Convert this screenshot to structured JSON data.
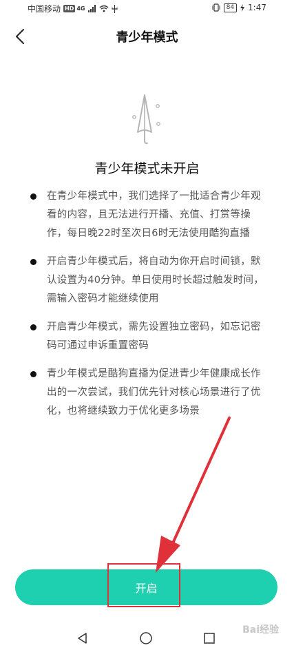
{
  "status_bar": {
    "carrier": "中国移动",
    "hd": "HD",
    "network": "4G",
    "battery": "84",
    "time": "1:47"
  },
  "header": {
    "title": "青少年模式"
  },
  "main": {
    "heading": "青少年模式未开启",
    "bullets": [
      "在青少年模式中，我们选择了一批适合青少年观看的内容，且无法进行开播、充值、打赏等操作，每日晚22时至次日6时无法使用酷狗直播",
      "开启青少年模式后，将自动为你开启时间锁，默认设置为40分钟。单日使用时长超过触发时间，需输入密码才能继续使用",
      "开启青少年模式，需先设置独立密码，如忘记密码可通过申诉重置密码",
      "青少年模式是酷狗直播为促进青少年健康成长作出的一次尝试，我们优先针对核心场景进行了优化，也将继续致力于优化更多场景"
    ],
    "start_button": "开启"
  },
  "watermark": "Bai经验",
  "colors": {
    "accent": "#1ecfb0",
    "annotation": "#e0313b"
  }
}
